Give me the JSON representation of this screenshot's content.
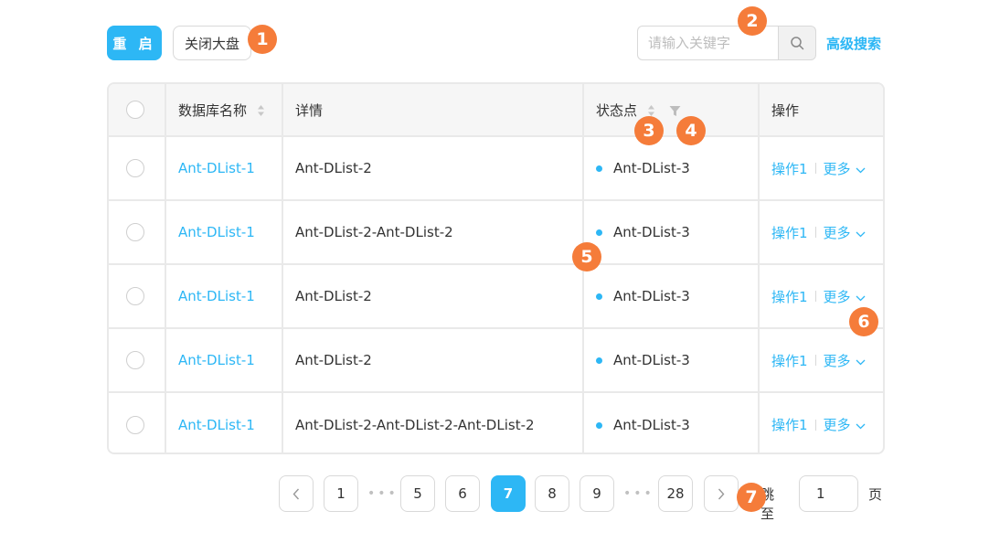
{
  "toolbar": {
    "restart_label": "重 启",
    "close_market_label": "关闭大盘",
    "search_placeholder": "请输入关键字",
    "advanced_search_label": "高级搜索"
  },
  "table": {
    "headers": {
      "name": "数据库名称",
      "detail": "详情",
      "status": "状态点",
      "actions": "操作"
    },
    "rows": [
      {
        "name": "Ant-DList-1",
        "detail": "Ant-DList-2",
        "status": "Ant-DList-3",
        "op1": "操作1",
        "more": "更多"
      },
      {
        "name": "Ant-DList-1",
        "detail": "Ant-DList-2-Ant-DList-2",
        "status": "Ant-DList-3",
        "op1": "操作1",
        "more": "更多"
      },
      {
        "name": "Ant-DList-1",
        "detail": "Ant-DList-2",
        "status": "Ant-DList-3",
        "op1": "操作1",
        "more": "更多"
      },
      {
        "name": "Ant-DList-1",
        "detail": "Ant-DList-2",
        "status": "Ant-DList-3",
        "op1": "操作1",
        "more": "更多"
      },
      {
        "name": "Ant-DList-1",
        "detail": "Ant-DList-2-Ant-DList-2-Ant-DList-2",
        "status": "Ant-DList-3",
        "op1": "操作1",
        "more": "更多"
      }
    ]
  },
  "pagination": {
    "pages": [
      "1",
      "5",
      "6",
      "7",
      "8",
      "9",
      "28"
    ],
    "current": "7",
    "ellipsis": "•••",
    "jump_label": "跳至",
    "jump_value": "1",
    "page_suffix": "页"
  },
  "annotations": [
    "1",
    "2",
    "3",
    "4",
    "5",
    "6",
    "7"
  ],
  "colors": {
    "accent": "#2db7f5",
    "annotation": "#f57c3a",
    "border": "#e9e9e9",
    "header_bg": "#f6f6f6"
  },
  "icons": {
    "search": "search-icon",
    "sort": "sort-icon",
    "filter": "filter-icon",
    "chevron": "chevron-down-icon",
    "prev": "chevron-left-icon",
    "next": "chevron-right-icon"
  }
}
